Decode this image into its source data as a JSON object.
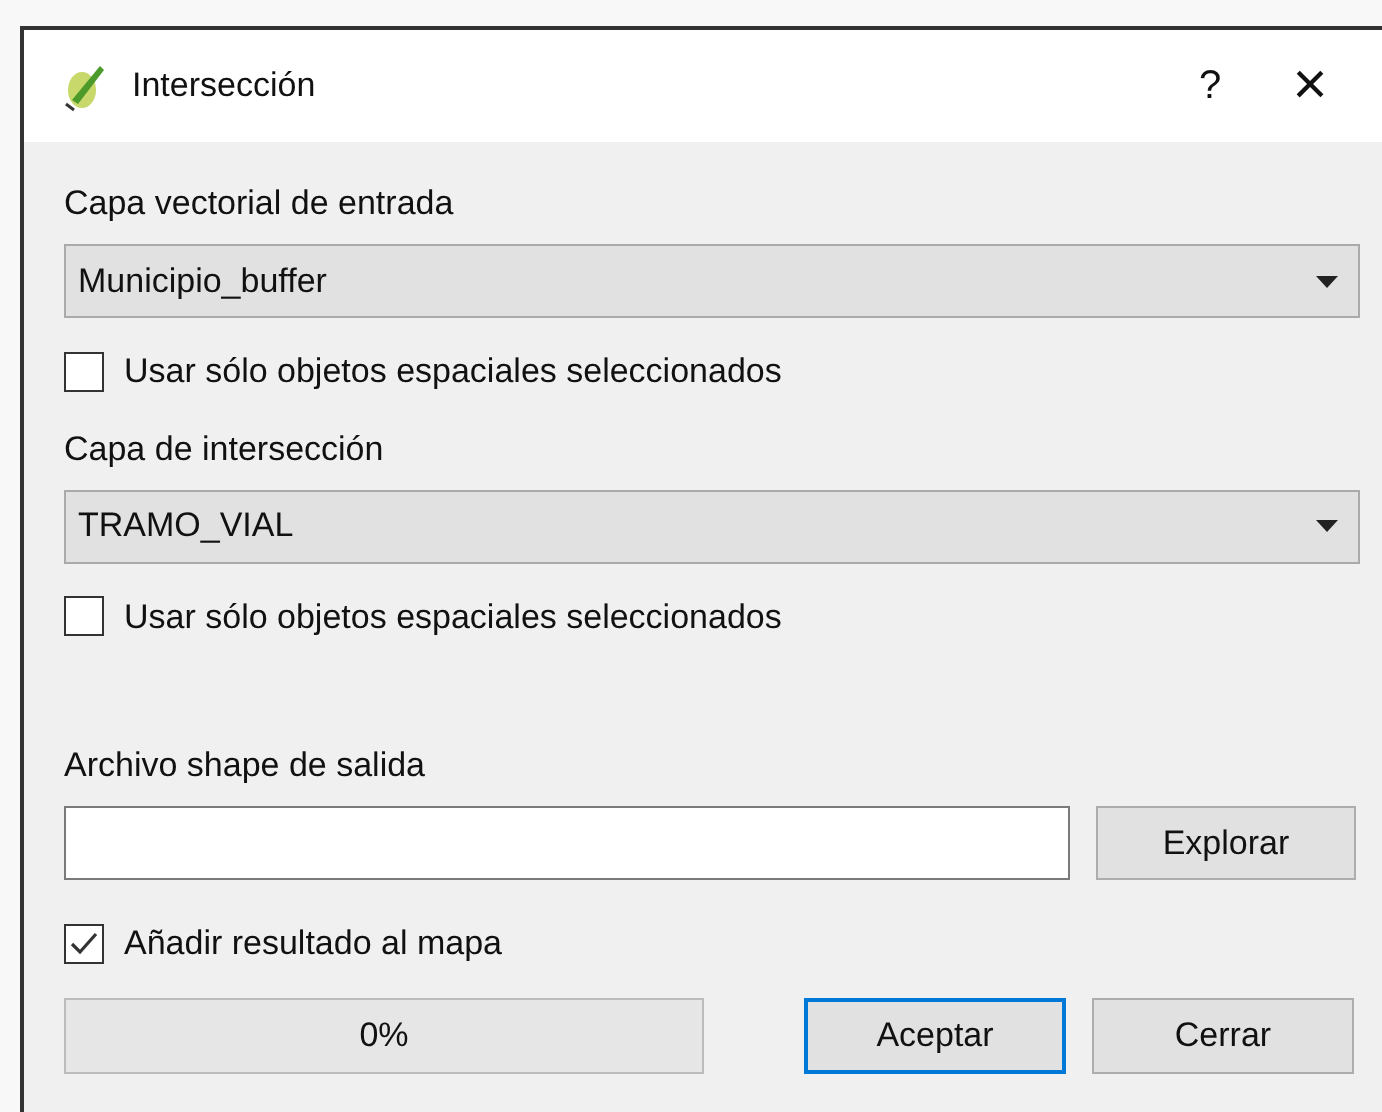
{
  "window": {
    "title": "Intersección",
    "help": "?",
    "close": "×"
  },
  "input_layer": {
    "label": "Capa vectorial de entrada",
    "value": "Municipio_buffer",
    "selected_only": {
      "label": "Usar sólo objetos espaciales seleccionados",
      "checked": false
    }
  },
  "intersect_layer": {
    "label": "Capa de intersección",
    "value": "TRAMO_VIAL",
    "selected_only": {
      "label": "Usar sólo objetos espaciales seleccionados",
      "checked": false
    }
  },
  "output": {
    "label": "Archivo shape de salida",
    "browse": "Explorar"
  },
  "add_to_map": {
    "label": "Añadir resultado al mapa",
    "checked": true
  },
  "progress": {
    "text": "0%"
  },
  "buttons": [
    {
      "label": "Aceptar",
      "default": true
    },
    {
      "label": "Cerrar",
      "default": false
    }
  ]
}
